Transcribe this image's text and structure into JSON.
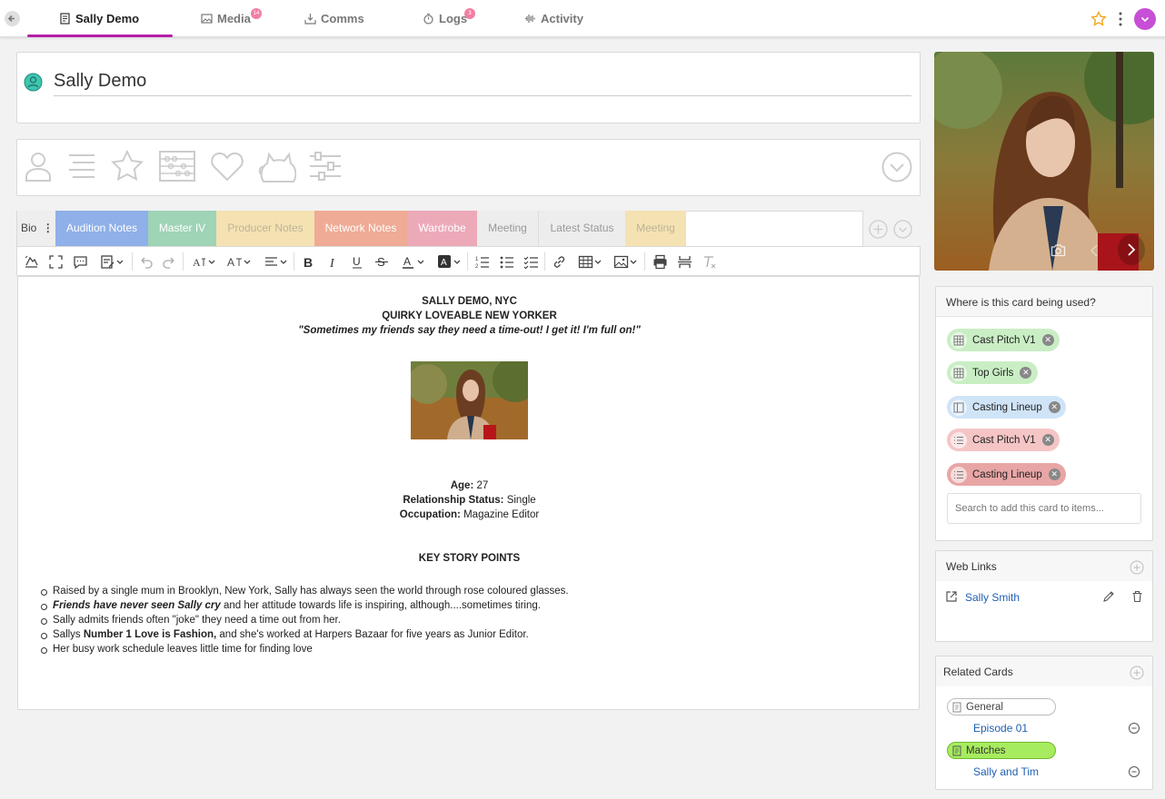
{
  "topbar": {
    "tabs": [
      {
        "label": "Sally Demo",
        "badge": ""
      },
      {
        "label": "Media",
        "badge": "14"
      },
      {
        "label": "Comms",
        "badge": ""
      },
      {
        "label": "Logs",
        "badge": "3"
      },
      {
        "label": "Activity",
        "badge": ""
      }
    ],
    "accent": "#b51fa8"
  },
  "profile": {
    "name": "Sally Demo"
  },
  "notes_tabs": [
    {
      "label": "Bio",
      "color": "#eeeeee"
    },
    {
      "label": "Audition Notes",
      "color": "#8fb0e8"
    },
    {
      "label": "Master IV",
      "color": "#9fd4b6"
    },
    {
      "label": "Producer Notes",
      "color": "#f5e2b2"
    },
    {
      "label": "Network Notes",
      "color": "#efab95"
    },
    {
      "label": "Wardrobe",
      "color": "#ecaab9"
    },
    {
      "label": "Meeting",
      "color": "#ededed"
    },
    {
      "label": "Latest Status",
      "color": "#ededed"
    },
    {
      "label": "Meeting",
      "color": "#f5e2b2"
    }
  ],
  "document": {
    "heading1": "SALLY DEMO, NYC",
    "heading2": "QUIRKY LOVEABLE NEW YORKER",
    "quote": "\"Sometimes my friends say they need a time-out! I get it! I'm full on!\"",
    "age_label": "Age:",
    "age_value": "27",
    "relationship_label": "Relationship Status:",
    "relationship_value": "Single",
    "occupation_label": "Occupation:",
    "occupation_value": "Magazine Editor",
    "story_heading": "KEY STORY POINTS",
    "bullets": [
      {
        "bold_italic": "",
        "bold": "",
        "text": "Raised by a single mum in Brooklyn, New York, Sally has always seen the world through rose coloured glasses."
      },
      {
        "bold_italic": "Friends have never seen Sally cry",
        "bold": "",
        "text": " and her attitude towards life is inspiring, although....sometimes tiring."
      },
      {
        "bold_italic": "",
        "bold": "",
        "text": "Sally admits friends often \"joke\" they need a time out from her."
      },
      {
        "bold_italic": "",
        "bold_prefix": "Sallys ",
        "bold": "Number 1 Love is Fashion,",
        "text": " and she's worked at Harpers Bazaar for five years as Junior Editor."
      },
      {
        "bold_italic": "",
        "bold": "",
        "text": "Her busy work schedule leaves little time for finding love"
      }
    ]
  },
  "usage": {
    "title": "Where is this card being used?",
    "chips": [
      {
        "label": "Cast Pitch V1",
        "color": "#c9eec4",
        "icon": "grid-icon"
      },
      {
        "label": "Top Girls",
        "color": "#c9eec4",
        "icon": "grid-icon"
      },
      {
        "label": "Casting Lineup",
        "color": "#cfe4f7",
        "icon": "columns-icon"
      },
      {
        "label": "Cast Pitch V1",
        "color": "#f5c5c5",
        "icon": "list-icon"
      },
      {
        "label": "Casting Lineup",
        "color": "#e8a5a5",
        "icon": "list-icon"
      }
    ],
    "search_placeholder": "Search to add this card to items..."
  },
  "weblinks": {
    "title": "Web Links",
    "items": [
      {
        "label": "Sally Smith"
      }
    ]
  },
  "related": {
    "title": "Related Cards",
    "groups": [
      {
        "label": "General",
        "color": "#ffffff",
        "item": "Episode 01"
      },
      {
        "label": "Matches",
        "color": "#a7ec5f",
        "item": "Sally and Tim"
      }
    ]
  }
}
